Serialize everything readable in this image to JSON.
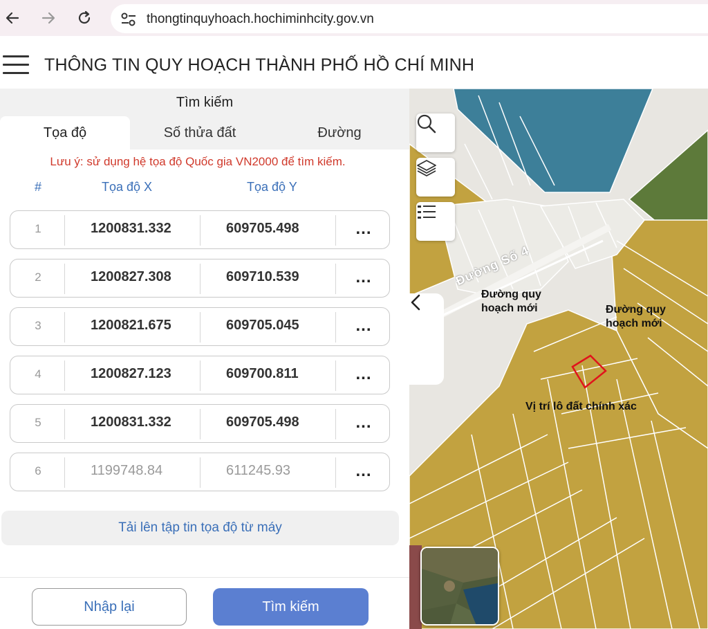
{
  "browser": {
    "url": "thongtinquyhoach.hochiminhcity.gov.vn"
  },
  "header": {
    "title": "THÔNG TIN QUY HOẠCH THÀNH PHỐ HỒ CHÍ MINH"
  },
  "panel": {
    "title": "Tìm kiếm",
    "tabs": [
      {
        "label": "Tọa độ",
        "active": true
      },
      {
        "label": "Số thửa đất",
        "active": false
      },
      {
        "label": "Đường",
        "active": false
      }
    ],
    "note": "Lưu ý: sử dụng hệ tọa độ Quốc gia VN2000 để tìm kiếm.",
    "columns": {
      "index": "#",
      "x": "Tọa độ X",
      "y": "Tọa độ Y"
    },
    "rows": [
      {
        "index": "1",
        "x": "1200831.332",
        "y": "609705.498",
        "more": "..."
      },
      {
        "index": "2",
        "x": "1200827.308",
        "y": "609710.539",
        "more": "..."
      },
      {
        "index": "3",
        "x": "1200821.675",
        "y": "609705.045",
        "more": "..."
      },
      {
        "index": "4",
        "x": "1200827.123",
        "y": "609700.811",
        "more": "..."
      },
      {
        "index": "5",
        "x": "1200831.332",
        "y": "609705.498",
        "more": "..."
      },
      {
        "index": "6",
        "x": "1199748.84",
        "y": "611245.93",
        "more": "...",
        "placeholder": true
      }
    ],
    "upload_label": "Tải lên tập tin tọa độ từ máy",
    "reset_label": "Nhập lại",
    "search_label": "Tìm kiếm"
  },
  "map": {
    "tools": [
      "search-icon",
      "layers-icon",
      "legend-list-icon"
    ],
    "collapse_icon": "chevron-left-icon",
    "street_name": "Đường Số 4",
    "labels": {
      "planned_road_1_line1": "Đường quy",
      "planned_road_1_line2": "hoạch mới",
      "planned_road_2_line1": "Đường quy",
      "planned_road_2_line2": "hoạch mới",
      "exact_lot": "Vị trí lô đất chính xác"
    },
    "colors": {
      "residential": "#c2a240",
      "water": "#3d7f99",
      "green": "#5d7a3a",
      "road": "#e8e6e1",
      "lot_highlight": "#e0141c"
    }
  }
}
